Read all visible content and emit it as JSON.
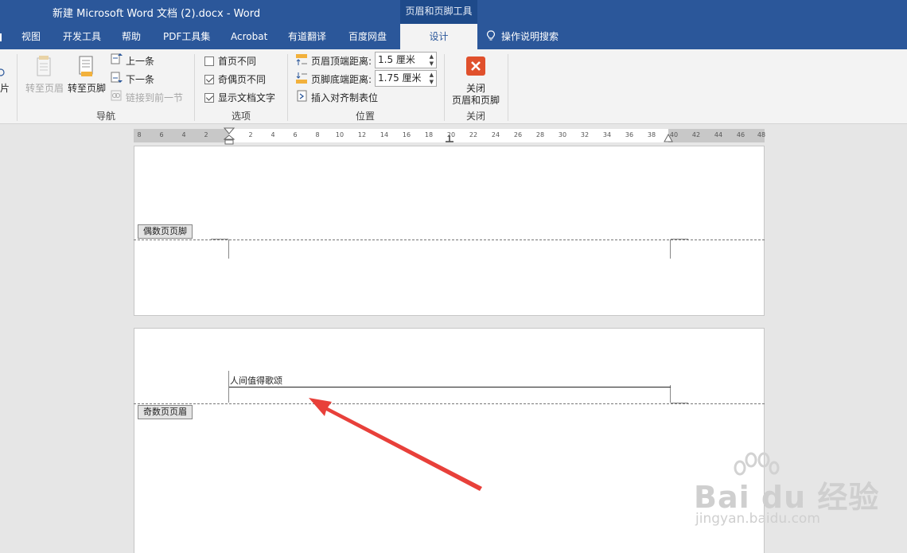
{
  "window": {
    "title": "新建 Microsoft Word 文档 (2).docx  -  Word",
    "context_tools": "页眉和页脚工具"
  },
  "tabs": [
    "视图",
    "开发工具",
    "帮助",
    "PDF工具集",
    "Acrobat",
    "有道翻译",
    "百度网盘",
    "设计"
  ],
  "tell_me": "操作说明搜索",
  "ribbon": {
    "partial_left": "片",
    "navigation": {
      "goto_header": "转至页眉",
      "goto_footer": "转至页脚",
      "previous": "上一条",
      "next": "下一条",
      "link_previous": "链接到前一节",
      "group_label": "导航"
    },
    "options": {
      "different_first": "首页不同",
      "different_odd_even": "奇偶页不同",
      "show_doc_text": "显示文档文字",
      "different_first_checked": false,
      "different_odd_even_checked": true,
      "show_doc_text_checked": true,
      "group_label": "选项"
    },
    "position": {
      "header_top_label": "页眉顶端距离:",
      "header_top_value": "1.5 厘米",
      "footer_bottom_label": "页脚底端距离:",
      "footer_bottom_value": "1.75 厘米",
      "insert_align_tab": "插入对齐制表位",
      "group_label": "位置"
    },
    "close": {
      "close_line1": "关闭",
      "close_line2": "页眉和页脚",
      "group_label": "关闭"
    }
  },
  "ruler_ticks": [
    "8",
    "6",
    "4",
    "2",
    "2",
    "4",
    "6",
    "8",
    "10",
    "12",
    "14",
    "16",
    "18",
    "20",
    "22",
    "24",
    "26",
    "28",
    "30",
    "32",
    "34",
    "36",
    "38",
    "40",
    "42",
    "44",
    "46",
    "48"
  ],
  "document": {
    "even_footer_tag": "偶数页页脚",
    "odd_header_tag": "奇数页页眉",
    "header_text": "人间值得歌颂"
  },
  "watermark": {
    "brand": "Bai du 经验",
    "url": "jingyan.baidu.com"
  },
  "colors": {
    "word_blue": "#2b579a",
    "close_red": "#e0502c",
    "annotation_arrow": "#e8403a"
  }
}
